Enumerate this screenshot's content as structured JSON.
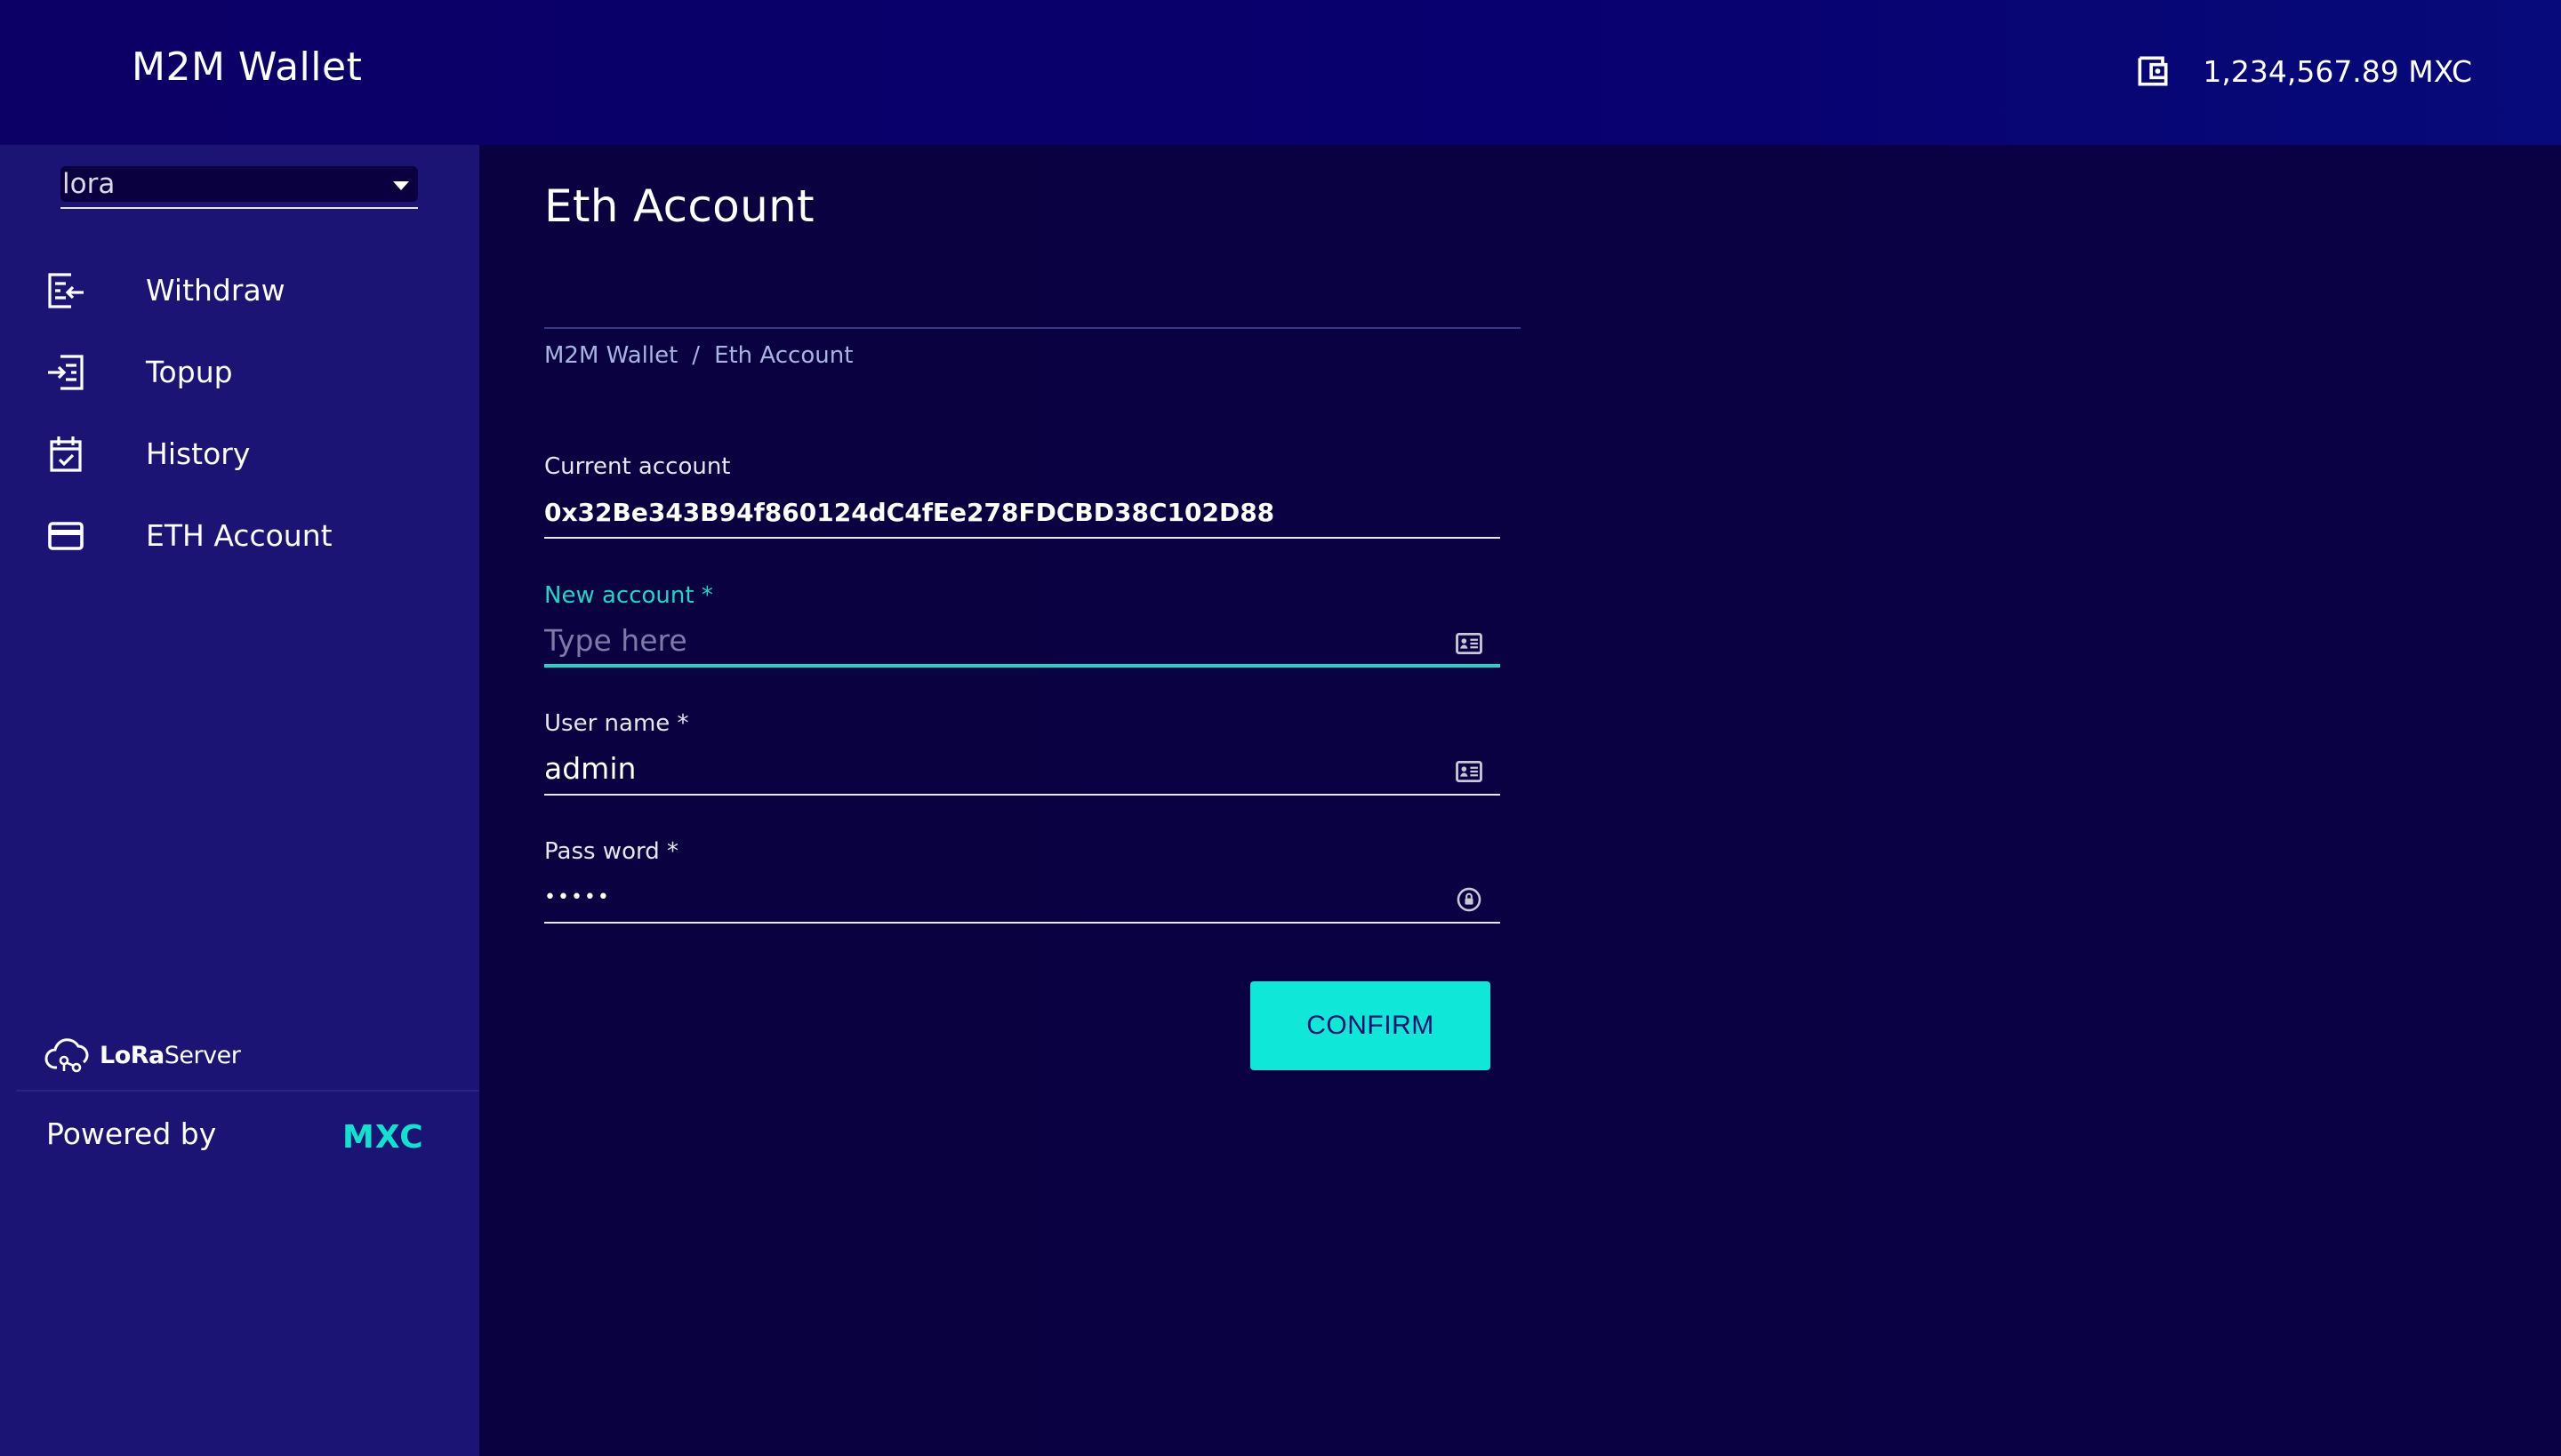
{
  "header": {
    "app_title": "M2M Wallet",
    "balance": "1,234,567.89 MXC",
    "wallet_icon": "wallet-icon"
  },
  "sidebar": {
    "org_select": {
      "value": "lora"
    },
    "items": [
      {
        "label": "Withdraw",
        "icon": "withdraw-icon"
      },
      {
        "label": "Topup",
        "icon": "topup-icon"
      },
      {
        "label": "History",
        "icon": "calendar-check-icon"
      },
      {
        "label": "ETH Account",
        "icon": "credit-card-icon"
      }
    ],
    "brand": {
      "lora": "LoRa",
      "server": "Server"
    },
    "powered_by": "Powered by",
    "mxc_logo": "MXC"
  },
  "main": {
    "title": "Eth Account",
    "breadcrumb": {
      "root": "M2M Wallet",
      "separator": "/",
      "current": "Eth Account"
    },
    "form": {
      "current_account": {
        "label": "Current account",
        "value": "0x32Be343B94f860124dC4fEe278FDCBD38C102D88"
      },
      "new_account": {
        "label": "New account *",
        "placeholder": "Type here",
        "icon": "id-card-icon"
      },
      "username": {
        "label": "User name *",
        "value": "admin",
        "icon": "id-card-icon"
      },
      "password": {
        "label": "Pass word *",
        "value": "•••••",
        "icon": "lock-icon"
      },
      "confirm_label": "CONFIRM"
    }
  },
  "colors": {
    "header_bg": "#0c0066",
    "sidebar_bg": "#1b1474",
    "main_bg": "#0a0140",
    "accent": "#0fe8d8"
  }
}
